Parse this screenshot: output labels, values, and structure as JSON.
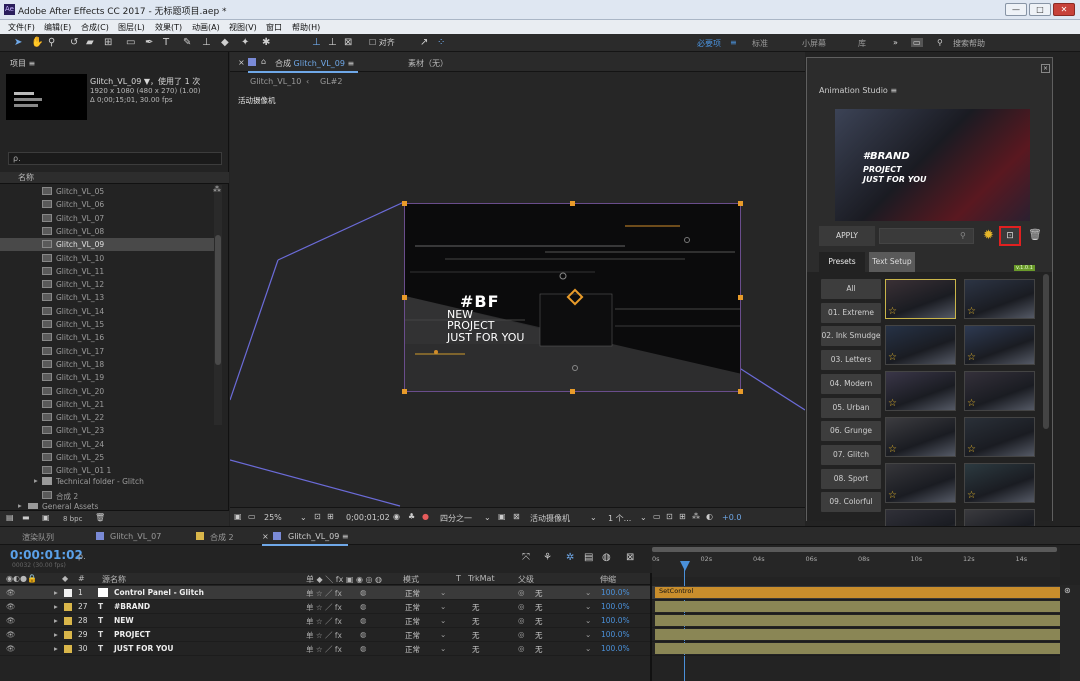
{
  "window": {
    "title": "Adobe After Effects CC 2017 - 无标题项目.aep *",
    "icon": "Ae",
    "controls": [
      "—",
      "□",
      "✕"
    ]
  },
  "menu": [
    "文件(F)",
    "编辑(E)",
    "合成(C)",
    "图层(L)",
    "效果(T)",
    "动画(A)",
    "视图(V)",
    "窗口",
    "帮助(H)"
  ],
  "toolbar": {
    "snap_label": "对齐",
    "workspaces": [
      "必要项",
      "标准",
      "小屏幕",
      "库"
    ],
    "active_workspace": "必要项",
    "more": "»",
    "search_placeholder": "搜索帮助"
  },
  "project": {
    "title": "项目",
    "comp_name": "Glitch_VL_09 ▼，使用了 1 次",
    "comp_size": "1920 x 1080 (480 x 270) (1.00)",
    "comp_duration": "Δ 0;00;15;01, 30.00 fps",
    "search_placeholder": "ρ.",
    "column_name": "名称",
    "items": [
      "Glitch_VL_05",
      "Glitch_VL_06",
      "Glitch_VL_07",
      "Glitch_VL_08",
      "Glitch_VL_09",
      "Glitch_VL_10",
      "Glitch_VL_11",
      "Glitch_VL_12",
      "Glitch_VL_13",
      "Glitch_VL_14",
      "Glitch_VL_15",
      "Glitch_VL_16",
      "Glitch_VL_17",
      "Glitch_VL_18",
      "Glitch_VL_19",
      "Glitch_VL_20",
      "Glitch_VL_21",
      "Glitch_VL_22",
      "Glitch_VL_23",
      "Glitch_VL_24",
      "Glitch_VL_25",
      "Glitch_VL_01 1"
    ],
    "selected_item": "Glitch_VL_09",
    "folder_technical": "Technical folder - Glitch",
    "comp_item": "合成 2",
    "folder_general": "General Assets",
    "footer_bpc": "8 bpc"
  },
  "viewer": {
    "tab_prefix": "合成",
    "tab_comp": "Glitch_VL_09",
    "tab_menu": "≡",
    "footage_tab": "素材（无）",
    "breadcrumb": [
      "Glitch_VL_10",
      "GL#2"
    ],
    "camera_label": "活动摄像机",
    "comp_text": {
      "brand": "#BF",
      "new": "NEW",
      "project": "PROJECT",
      "just": "JUST FOR YOU"
    },
    "bottom": {
      "zoom": "25%",
      "timecode": "0;00;01;02",
      "resolution": "四分之一",
      "camera": "活动摄像机",
      "views": "1 个...",
      "exposure": "+0.0"
    }
  },
  "animation_studio": {
    "title": "Animation Studio",
    "preview_text": {
      "brand": "#BRAND",
      "project": "PROJECT",
      "just": "JUST FOR YOU"
    },
    "apply": "APPLY",
    "tabs": [
      "Presets",
      "Text Setup"
    ],
    "version_badge": "v.1.0.1",
    "categories": [
      "All",
      "01. Extreme",
      "02. Ink Smudge",
      "03. Letters",
      "04. Modern",
      "05. Urban",
      "06. Grunge",
      "07. Glitch",
      "08. Sport",
      "09. Colorful"
    ]
  },
  "timeline": {
    "tabs": [
      "渲染队列",
      "Glitch_VL_07",
      "合成 2",
      "Glitch_VL_09"
    ],
    "active_tab": "Glitch_VL_09",
    "timecode": "0:00:01:02",
    "timecode_sub": "00032 (30.00 fps)",
    "search_placeholder": "ρ.",
    "headers": {
      "num": "#",
      "name": "源名称",
      "switches": "单 ◆ ＼ fx ▣ ◉ ◎ ◍",
      "mode": "模式",
      "t": "T",
      "trkmat": "TrkMat",
      "parent": "父级",
      "stretch": "伸缩"
    },
    "ruler": [
      "0s",
      "02s",
      "04s",
      "06s",
      "08s",
      "10s",
      "12s",
      "14s"
    ],
    "layers": [
      {
        "num": "1",
        "name": "Control Panel - Glitch",
        "mode": "正常",
        "trkmat": "",
        "parent": "无",
        "stretch": "100.0%",
        "bar_label": "SetControl",
        "color": "#f0f0f0",
        "selected": true
      },
      {
        "num": "27",
        "name": "#BRAND",
        "mode": "正常",
        "trkmat": "无",
        "parent": "无",
        "stretch": "100.0%",
        "bar_label": "",
        "color": "#d9b64a",
        "selected": false
      },
      {
        "num": "28",
        "name": "NEW",
        "mode": "正常",
        "trkmat": "无",
        "parent": "无",
        "stretch": "100.0%",
        "bar_label": "",
        "color": "#d9b64a",
        "selected": false
      },
      {
        "num": "29",
        "name": "PROJECT",
        "mode": "正常",
        "trkmat": "无",
        "parent": "无",
        "stretch": "100.0%",
        "bar_label": "",
        "color": "#d9b64a",
        "selected": false
      },
      {
        "num": "30",
        "name": "JUST FOR YOU",
        "mode": "正常",
        "trkmat": "无",
        "parent": "无",
        "stretch": "100.0%",
        "bar_label": "",
        "color": "#d9b64a",
        "selected": false
      }
    ]
  }
}
